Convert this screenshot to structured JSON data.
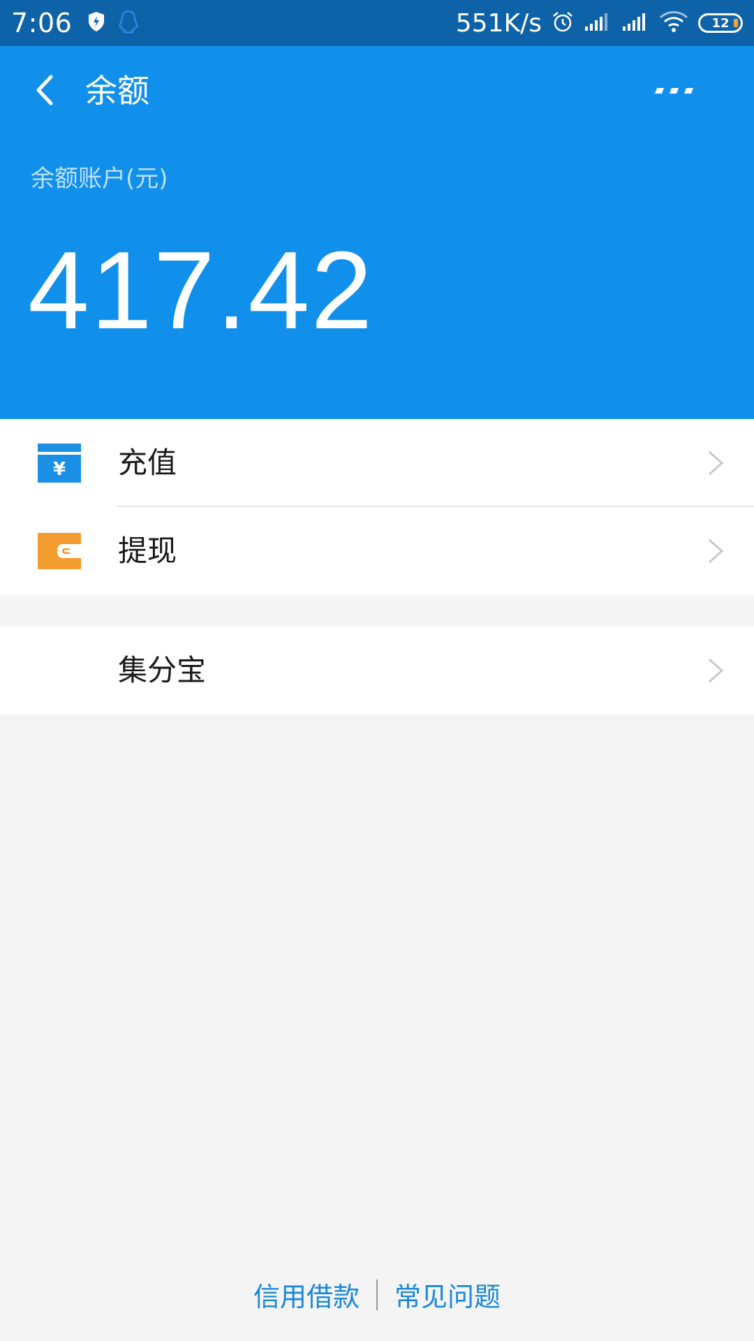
{
  "status_bar": {
    "time": "7:06",
    "network_speed": "551K/s",
    "battery": "12",
    "icons": [
      "shield-bolt-icon",
      "qq-penguin-icon",
      "alarm-icon",
      "signal-icon",
      "signal-icon",
      "wifi-icon",
      "battery-icon"
    ]
  },
  "header": {
    "title": "余额",
    "back_icon": "chevron-left-icon",
    "more_icon": "more-icon",
    "account_label": "余额账户(元)",
    "balance": "417.42"
  },
  "menu": {
    "items": [
      {
        "label": "充值",
        "icon": "recharge-icon",
        "icon_color": "#1a8fe3"
      },
      {
        "label": "提现",
        "icon": "wallet-icon",
        "icon_color": "#f39c2f"
      }
    ],
    "secondary_items": [
      {
        "label": "集分宝"
      }
    ]
  },
  "footer": {
    "links": [
      "信用借款",
      "常见问题"
    ]
  },
  "colors": {
    "status_bar": "#0e63a8",
    "header": "#1190eb",
    "page_background": "#f4f4f4",
    "link": "#1a88d8"
  }
}
